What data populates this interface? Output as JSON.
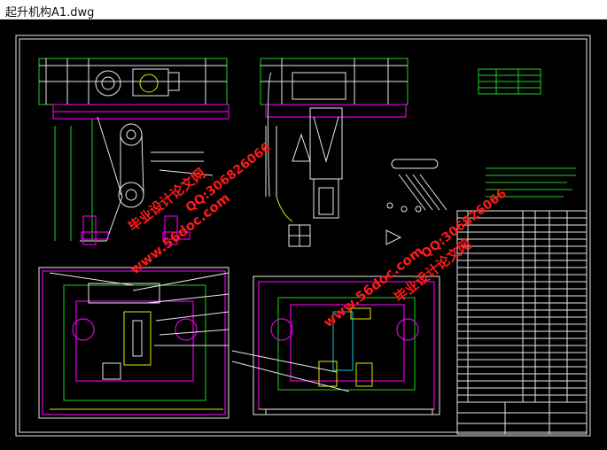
{
  "window": {
    "title": "起升机构A1.dwg"
  },
  "colors": {
    "background": "#000000",
    "frame": "#e8e8e8",
    "green": "#1fd21f",
    "magenta": "#e000e0",
    "yellow": "#e6e600",
    "watermark": "#ff1a1a"
  },
  "watermarks": {
    "site_1": "www.56doc.com",
    "brand_1": "毕业设计论文网",
    "qq_1": "QQ:306826066",
    "site_2": "www.56doc.com",
    "brand_2": "毕业设计论文网",
    "qq_2": "QQ:306826066"
  },
  "drawing": {
    "view": "cad-drawing",
    "icons": [
      "watermark-text",
      "title-block",
      "parts-list-table"
    ]
  }
}
